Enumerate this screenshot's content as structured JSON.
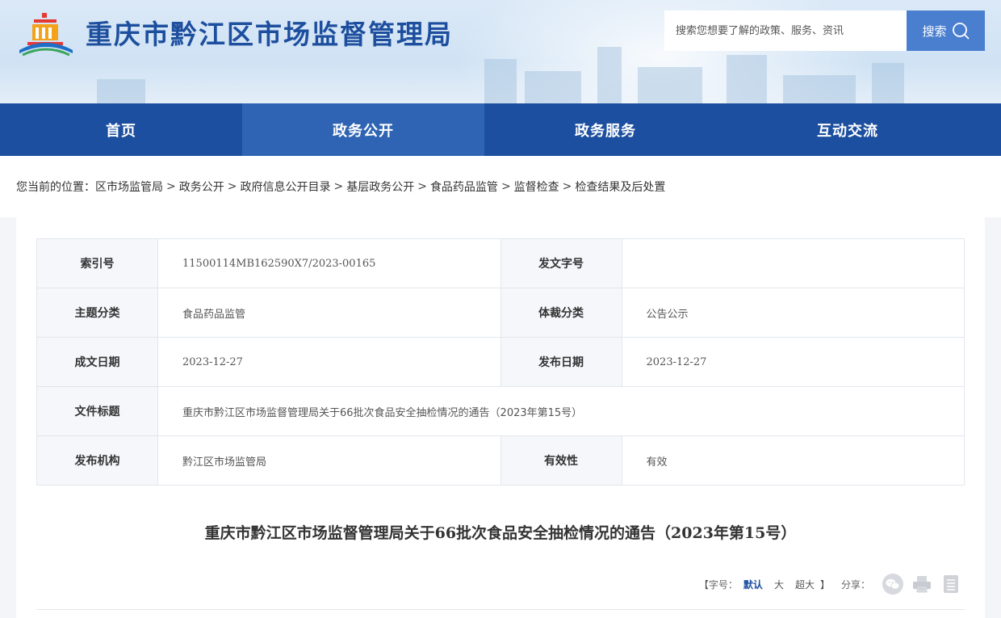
{
  "header": {
    "site_title": "重庆市黔江区市场监督管理局",
    "search_placeholder": "搜索您想要了解的政策、服务、资讯",
    "search_label": "搜索"
  },
  "nav": {
    "items": [
      {
        "label": "首页"
      },
      {
        "label": "政务公开"
      },
      {
        "label": "政务服务"
      },
      {
        "label": "互动交流"
      }
    ]
  },
  "breadcrumb": {
    "prefix": "您当前的位置：",
    "items": [
      "区市场监管局",
      "政务公开",
      "政府信息公开目录",
      "基层政务公开",
      "食品药品监管",
      "监督检查",
      "检查结果及后处置"
    ],
    "sep": ">"
  },
  "meta": {
    "index_label": "索引号",
    "index_value": "11500114MB162590X7/2023-00165",
    "docno_label": "发文字号",
    "docno_value": "",
    "topic_label": "主题分类",
    "topic_value": "食品药品监管",
    "genre_label": "体裁分类",
    "genre_value": "公告公示",
    "created_label": "成文日期",
    "created_value": "2023-12-27",
    "published_label": "发布日期",
    "published_value": "2023-12-27",
    "doctitle_label": "文件标题",
    "doctitle_value": "重庆市黔江区市场监督管理局关于66批次食品安全抽检情况的通告（2023年第15号）",
    "org_label": "发布机构",
    "org_value": "黔江区市场监管局",
    "validity_label": "有效性",
    "validity_value": "有效"
  },
  "article": {
    "title": "重庆市黔江区市场监督管理局关于66批次食品安全抽检情况的通告（2023年第15号）"
  },
  "tools": {
    "bracket_open": "【",
    "font_label": "字号：",
    "size_default": "默认",
    "size_large": "大",
    "size_xlarge": "超大",
    "bracket_close": "】",
    "share_label": "分享："
  },
  "colors": {
    "brand": "#1c4f9f",
    "nav_active": "#2e64b3",
    "search_button": "#4a7fd0"
  }
}
